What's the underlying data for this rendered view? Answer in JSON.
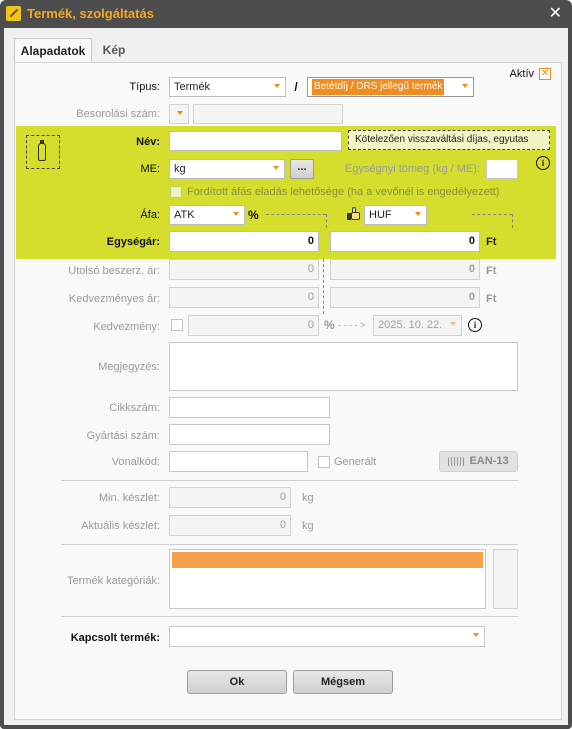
{
  "window": {
    "title": "Termék, szolgáltatás",
    "close_glyph": "✕"
  },
  "tabs": [
    {
      "label": "Alapadatok",
      "active": true
    },
    {
      "label": "Kép",
      "active": false
    }
  ],
  "aktiv": {
    "label": "Aktív",
    "checked": true
  },
  "tipus": {
    "label": "Típus:",
    "value": "Termék",
    "separator": "/",
    "subtype": "Betétdíj / DRS jellegű termék"
  },
  "besorolasi": {
    "label": "Besorolási szám:",
    "value": ""
  },
  "nev": {
    "label": "Név:",
    "value": "",
    "note": "Kötelezően visszaváltási díjas, egyutas"
  },
  "me": {
    "label": "ME:",
    "value": "kg",
    "ellipsis": "...",
    "weight_label": "Egységnyi tömeg (kg / ME):",
    "weight_value": ""
  },
  "reverse_vat": {
    "label": "Fordított áfás eladás lehetősége (ha a vevőnél is engedélyezett)",
    "checked": false
  },
  "afa": {
    "label": "Áfa:",
    "value": "ATK",
    "percent": "%",
    "currency": "HUF"
  },
  "egysegar": {
    "label": "Egységár:",
    "net": "0",
    "gross": "0",
    "unit": "Ft"
  },
  "utolso": {
    "label": "Utolsó beszerz. ár:",
    "net": "0",
    "gross": "0",
    "unit": "Ft"
  },
  "kedvezmenyes_ar": {
    "label": "Kedvezményes ár:",
    "net": "0",
    "gross": "0",
    "unit": "Ft"
  },
  "kedvezmeny": {
    "label": "Kedvezmény:",
    "value": "0",
    "percent": "%",
    "arrow": "- - - - >",
    "date": "2025. 10. 22."
  },
  "megjegyzes": {
    "label": "Megjegyzés:",
    "value": ""
  },
  "cikkszam": {
    "label": "Cikkszám:",
    "value": ""
  },
  "gyartasi": {
    "label": "Gyártási szám:",
    "value": ""
  },
  "vonalkod": {
    "label": "Vonalkód:",
    "value": "",
    "generalt": "Generált",
    "ean_button": "EAN-13"
  },
  "min_keszlet": {
    "label": "Min. készlet:",
    "value": "0",
    "unit": "kg"
  },
  "akt_keszlet": {
    "label": "Aktuális készlet:",
    "value": "0",
    "unit": "kg"
  },
  "kategoriak": {
    "label": "Termék kategóriák:"
  },
  "kapcsolt": {
    "label": "Kapcsolt termék:",
    "value": ""
  },
  "buttons": {
    "ok": "Ok",
    "cancel": "Mégsem"
  },
  "colors": {
    "accent": "#f28c1e",
    "title": "#f5a623",
    "green_panel": "#d5de2d",
    "frame": "#4d4d4d"
  },
  "icons": {
    "title": "edit-icon",
    "close": "close-icon",
    "recycle": "bottle-icon",
    "info": "info-icon",
    "thumb": "thumb-icon",
    "barcode": "barcode-icon"
  }
}
